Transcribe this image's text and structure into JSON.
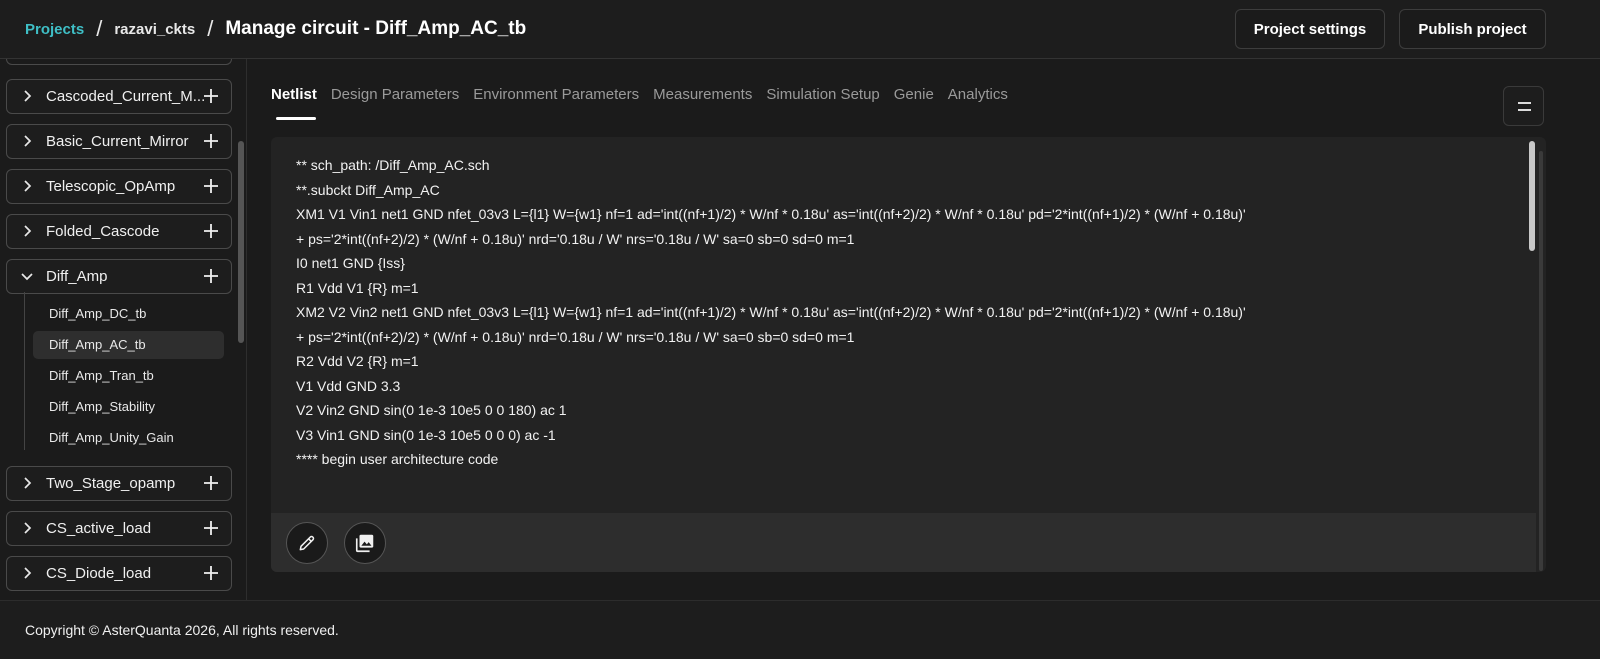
{
  "header": {
    "breadcrumb_root": "Projects",
    "breadcrumb_project": "razavi_ckts",
    "page_title": "Manage circuit - Diff_Amp_AC_tb",
    "sep": "/",
    "project_settings_label": "Project settings",
    "publish_label": "Publish project"
  },
  "sidebar": {
    "groups": [
      {
        "label": "Cascoded_Current_M...",
        "expanded": false
      },
      {
        "label": "Basic_Current_Mirror",
        "expanded": false
      },
      {
        "label": "Telescopic_OpAmp",
        "expanded": false
      },
      {
        "label": "Folded_Cascode",
        "expanded": false
      },
      {
        "label": "Diff_Amp",
        "expanded": true
      },
      {
        "label": "Two_Stage_opamp",
        "expanded": false
      },
      {
        "label": "CS_active_load",
        "expanded": false
      },
      {
        "label": "CS_Diode_load",
        "expanded": false
      }
    ],
    "sub_items": [
      {
        "label": "Diff_Amp_DC_tb",
        "active": false
      },
      {
        "label": "Diff_Amp_AC_tb",
        "active": true
      },
      {
        "label": "Diff_Amp_Tran_tb",
        "active": false
      },
      {
        "label": "Diff_Amp_Stability",
        "active": false
      },
      {
        "label": "Diff_Amp_Unity_Gain",
        "active": false
      }
    ]
  },
  "tabs": [
    {
      "label": "Netlist",
      "active": true
    },
    {
      "label": "Design Parameters",
      "active": false
    },
    {
      "label": "Environment Parameters",
      "active": false
    },
    {
      "label": "Measurements",
      "active": false
    },
    {
      "label": "Simulation Setup",
      "active": false
    },
    {
      "label": "Genie",
      "active": false
    },
    {
      "label": "Analytics",
      "active": false
    }
  ],
  "netlist_lines": [
    "** sch_path: /Diff_Amp_AC.sch",
    "**.subckt Diff_Amp_AC",
    "XM1 V1 Vin1 net1 GND nfet_03v3 L={l1} W={w1} nf=1 ad='int((nf+1)/2) * W/nf * 0.18u' as='int((nf+2)/2) * W/nf * 0.18u' pd='2*int((nf+1)/2) * (W/nf + 0.18u)'",
    "+ ps='2*int((nf+2)/2) * (W/nf + 0.18u)' nrd='0.18u / W' nrs='0.18u / W' sa=0 sb=0 sd=0 m=1",
    "I0 net1 GND {Iss}",
    "R1 Vdd V1 {R} m=1",
    "XM2 V2 Vin2 net1 GND nfet_03v3 L={l1} W={w1} nf=1 ad='int((nf+1)/2) * W/nf * 0.18u' as='int((nf+2)/2) * W/nf * 0.18u' pd='2*int((nf+1)/2) * (W/nf + 0.18u)'",
    "+ ps='2*int((nf+2)/2) * (W/nf + 0.18u)' nrd='0.18u / W' nrs='0.18u / W' sa=0 sb=0 sd=0 m=1",
    "R2 Vdd V2 {R} m=1",
    "V1 Vdd GND 3.3",
    "V2 Vin2 GND sin(0 1e-3 10e5 0 0 180) ac 1",
    "V3 Vin1 GND sin(0 1e-3 10e5 0 0 0) ac -1",
    "**** begin user architecture code"
  ],
  "footer": {
    "copyright": "Copyright © AsterQuanta 2026, All rights reserved."
  },
  "icons": {
    "edit": "pencil-icon",
    "gallery": "image-gallery-icon",
    "menu": "menu-icon",
    "expand": "chevron-right-icon",
    "collapse": "chevron-down-icon",
    "add": "plus-icon"
  },
  "colors": {
    "accent": "#3fbfc6",
    "background": "#1b1b1b",
    "panel": "#232323"
  }
}
